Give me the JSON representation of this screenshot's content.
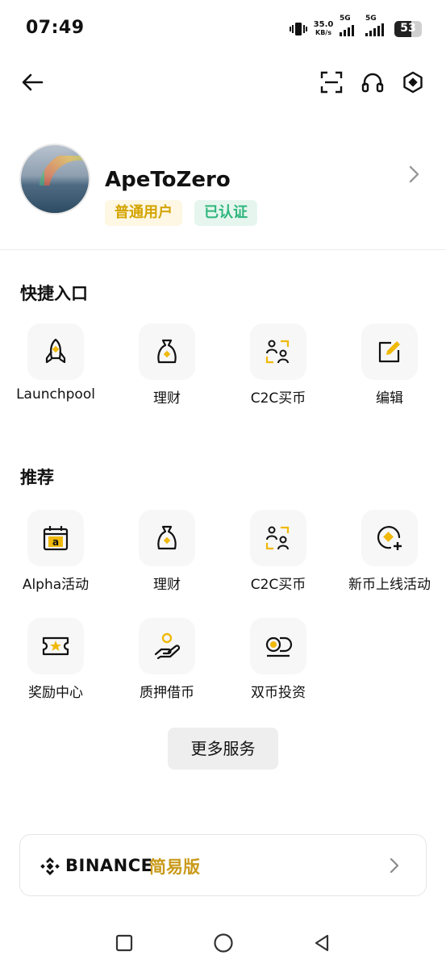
{
  "status_bar": {
    "time": "07:49",
    "speed_value": "35.0",
    "speed_unit": "KB/s",
    "network_1": "5G",
    "network_2": "5G",
    "battery": "53"
  },
  "topbar": {
    "icons": [
      "back-arrow-icon",
      "scan-icon",
      "headset-icon",
      "settings-hex-icon"
    ]
  },
  "profile": {
    "username": "ApeToZero",
    "badge_level": "普通用户",
    "badge_verified": "已认证"
  },
  "quick_access": {
    "title": "快捷入口",
    "items": [
      {
        "label": "Launchpool",
        "icon": "rocket-icon"
      },
      {
        "label": "理财",
        "icon": "money-bag-icon"
      },
      {
        "label": "C2C买币",
        "icon": "c2c-users-icon"
      },
      {
        "label": "编辑",
        "icon": "edit-icon"
      }
    ]
  },
  "recommend": {
    "title": "推荐",
    "items": [
      {
        "label": "Alpha活动",
        "icon": "alpha-calendar-icon"
      },
      {
        "label": "理财",
        "icon": "money-bag-icon"
      },
      {
        "label": "C2C买币",
        "icon": "c2c-users-icon"
      },
      {
        "label": "新币上线活动",
        "icon": "new-coin-icon"
      },
      {
        "label": "奖励中心",
        "icon": "reward-ticket-icon"
      },
      {
        "label": "质押借币",
        "icon": "loan-hand-icon"
      },
      {
        "label": "双币投资",
        "icon": "dual-coin-icon"
      }
    ]
  },
  "more_services": "更多服务",
  "binance_lite": {
    "brand": "BINANCE",
    "mode": "简易版"
  },
  "colors": {
    "accent": "#F0B90B",
    "verified_green": "#2EB67D",
    "gold_text": "#C99A1A"
  }
}
